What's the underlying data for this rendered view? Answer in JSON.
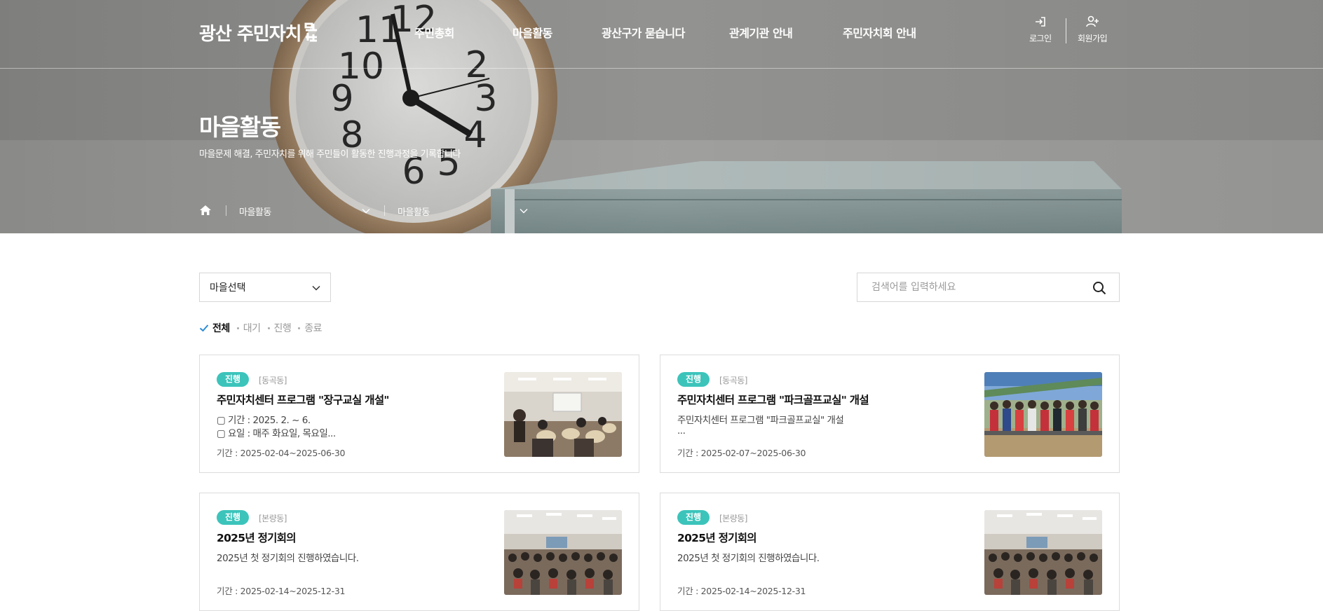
{
  "header": {
    "logo_text": "광산 주민자치",
    "nav": [
      "주민총회",
      "마을활동",
      "광산구가 묻습니다",
      "관계기관 안내",
      "주민자치회 안내"
    ],
    "login_label": "로그인",
    "signup_label": "회원가입"
  },
  "hero": {
    "title": "마을활동",
    "description": "마을문제 해결, 주민자치를 위해 주민들이 활동한 진행과정을 기록합니다",
    "breadcrumb": [
      "마을활동",
      "마을활동"
    ]
  },
  "toolbar": {
    "village_select": "마을선택",
    "search_placeholder": "검색어를 입력하세요"
  },
  "filters": [
    "전체",
    "대기",
    "진행",
    "종료"
  ],
  "cards": [
    {
      "status": "진행",
      "region": "[동곡동]",
      "title": "주민자치센터 프로그램 \"장구교실 개설\"",
      "line1": "▢ 기간 : 2025. 2. ~ 6.",
      "line2": "▢ 요일 : 매주 화요일, 목요일...",
      "period": "기간 : 2025-02-04~2025-06-30",
      "thumb_icon": "classroom-drum-photo"
    },
    {
      "status": "진행",
      "region": "[동곡동]",
      "title": "주민자치센터 프로그램 \"파크골프교실\" 개설",
      "line1": "주민자치센터 프로그램 \"파크골프교실\" 개설",
      "line2": "...",
      "period": "기간 : 2025-02-07~2025-06-30",
      "thumb_icon": "group-outdoor-photo"
    },
    {
      "status": "진행",
      "region": "[본량동]",
      "title": "2025년 정기회의",
      "line1": "2025년 첫 정기회의 진행하였습니다.",
      "line2": "",
      "period": "기간 : 2025-02-14~2025-12-31",
      "thumb_icon": "meeting-hall-photo"
    },
    {
      "status": "진행",
      "region": "[본량동]",
      "title": "2025년 정기회의",
      "line1": "2025년 첫 정기회의 진행하였습니다.",
      "line2": "",
      "period": "기간 : 2025-02-14~2025-12-31",
      "thumb_icon": "meeting-hall-photo"
    }
  ],
  "colors": {
    "badge": "#3cc4bb",
    "check": "#2a8cd6",
    "border": "#dcdcdc"
  }
}
